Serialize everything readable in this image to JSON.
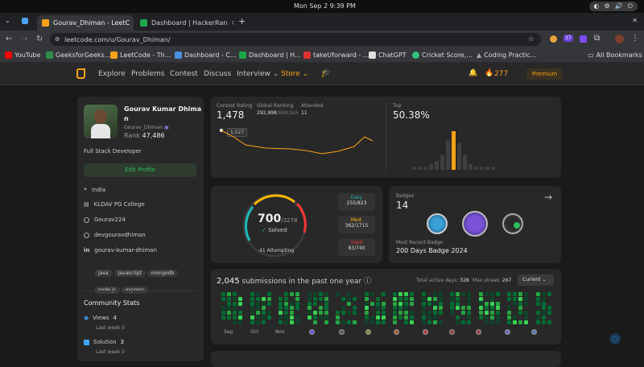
{
  "os": {
    "clock": "Mon Sep 2   9:39 PM",
    "tray": [
      "◐",
      "⚙",
      "🔊",
      "⏻"
    ]
  },
  "browser": {
    "tabs": [
      {
        "label": "Gourav_Dhiman - LeetC",
        "color": "#ffa116"
      },
      {
        "label": "Dashboard | HackerRan",
        "color": "#1ba94c"
      }
    ],
    "new_tab": "+",
    "url": "leetcode.com/u/Gourav_Dhiman/",
    "ext_badge": "37",
    "bookmarks": [
      {
        "label": "YouTube",
        "color": "#ff0000"
      },
      {
        "label": "GeeksforGeeks...",
        "color": "#2f8d46"
      },
      {
        "label": "LeetCode - Th...",
        "color": "#ffa116"
      },
      {
        "label": "Dashboard - C...",
        "color": "#4a90e2"
      },
      {
        "label": "Dashboard | H...",
        "color": "#1ba94c"
      },
      {
        "label": "takeUforward - ...",
        "color": "#d33"
      },
      {
        "label": "ChatGPT",
        "color": "#ddd"
      },
      {
        "label": "Cricket Score,...",
        "color": "#2ec27e"
      },
      {
        "label": "Coding Practic...",
        "color": "#aaa"
      }
    ],
    "all_bookmarks": "All Bookmarks"
  },
  "nav": {
    "items": [
      "Explore",
      "Problems",
      "Contest",
      "Discuss",
      "Interview ⌄"
    ],
    "store": "Store ⌄",
    "streak": "277",
    "premium": "Premium"
  },
  "profile": {
    "name_line1": "Gourav Kumar Dhima",
    "name_line2": "n",
    "username": "Gourav_Dhiman",
    "rank_label": "Rank",
    "rank": "47,486",
    "bio": "Full Stack Developer",
    "edit": "Edit Profile",
    "location": "India",
    "college": "KLDAV PG College",
    "github": "Gourav224",
    "twitter": "devgouravdhiman",
    "linkedin": "gourav-kumar-dhiman",
    "skills": [
      "java",
      "javascript",
      "mongodb",
      "node.js",
      "express"
    ],
    "stats_title": "Community Stats",
    "views_label": "Views",
    "views": "4",
    "views_sub": "Last week",
    "views_sub_val": "0",
    "sol_label": "Solution",
    "sol": "3",
    "sol_sub": "Last week",
    "sol_sub_val": "0"
  },
  "contest": {
    "rating_label": "Contest Rating",
    "rating": "1,478",
    "global_label": "Global Ranking",
    "global": "292,998",
    "global_total": "/688,926",
    "attended_label": "Attended",
    "attended": "11",
    "tooltip": "1,527",
    "top_label": "Top",
    "top": "50.38%"
  },
  "chart_data": {
    "type": "bar",
    "values": [
      1,
      1,
      1,
      2,
      3,
      5,
      10,
      13,
      9,
      5,
      2,
      1,
      1,
      1,
      1
    ],
    "highlight_index": 7
  },
  "solved": {
    "count": "700",
    "total": "/3278",
    "label": "Solved",
    "attempting": "41 Attempting",
    "easy_label": "Easy",
    "easy": "255/823",
    "med_label": "Med.",
    "med": "362/1715",
    "hard_label": "Hard",
    "hard": "83/740"
  },
  "badges": {
    "label": "Badges",
    "count": "14",
    "recent_label": "Most Recent Badge",
    "recent": "200 Days Badge 2024",
    "arrow": "→"
  },
  "subs": {
    "count": "2,045",
    "text": " submissions in the past one year ⓘ",
    "active_label": "Total active days:",
    "active": "328",
    "streak_label": "Max streak:",
    "streak": "267",
    "period": "Current ⌄",
    "months": [
      "Sep",
      "Oct",
      "Nov"
    ]
  }
}
